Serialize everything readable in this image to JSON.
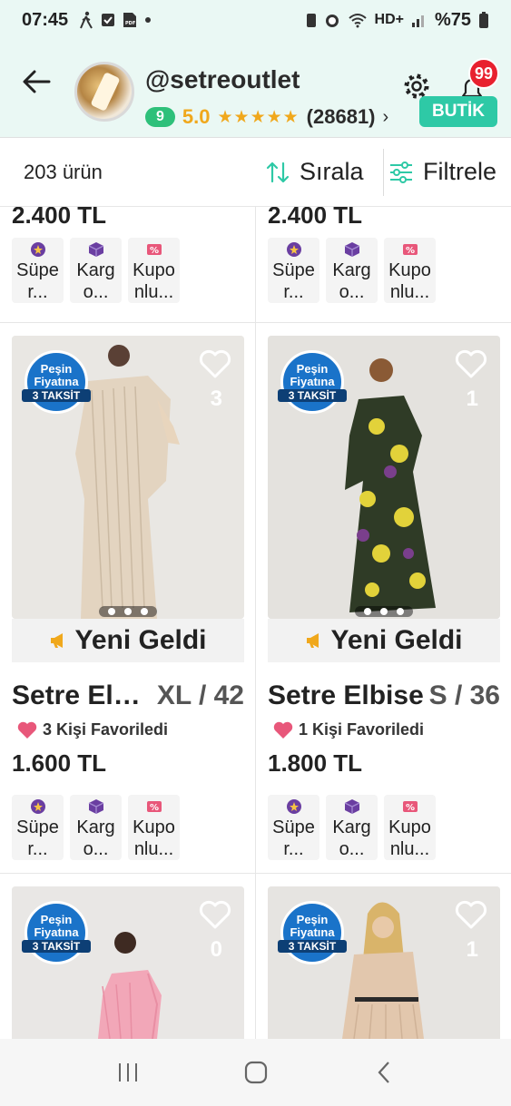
{
  "status_bar": {
    "time": "07:45",
    "battery": "%75",
    "network": "HD+"
  },
  "store": {
    "name": "@setreoutlet",
    "level": "9",
    "rating": "5.0",
    "stars": "★★★★★",
    "review_count": "(28681)",
    "chevron": "›",
    "notification_count": "99",
    "tag": "BUTİK"
  },
  "filter_bar": {
    "product_count": "203 ürün",
    "sort_label": "Sırala",
    "filter_label": "Filtrele"
  },
  "colors": {
    "accent": "#2ec9a6",
    "rating": "#f0a81c",
    "level": "#2ec07a",
    "badge": "#e8212f",
    "taksit": "#1a73c9"
  },
  "features": [
    {
      "label": "Süpe r...",
      "icon": "super-seller-icon",
      "color": "#6a3ea1"
    },
    {
      "label": "Karg o...",
      "icon": "cargo-box-icon",
      "color": "#6a3ea1"
    },
    {
      "label": "Kupo nlu...",
      "icon": "coupon-icon",
      "color": "#e8577a"
    }
  ],
  "products": [
    {
      "price": "2.400 TL"
    },
    {
      "price": "2.400 TL"
    },
    {
      "taksit_line1": "Peşin",
      "taksit_line2": "Fiyatına",
      "taksit_line3": "3 TAKSİT",
      "favorite_count": "3",
      "new_label": "Yeni Geldi",
      "name": "Setre Elbise",
      "size": "XL / 42",
      "favorites_text": "3 Kişi Favoriledi",
      "price": "1.600 TL"
    },
    {
      "taksit_line1": "Peşin",
      "taksit_line2": "Fiyatına",
      "taksit_line3": "3 TAKSİT",
      "favorite_count": "1",
      "new_label": "Yeni Geldi",
      "name": "Setre Elbise",
      "size": "S / 36",
      "favorites_text": "1 Kişi Favoriledi",
      "price": "1.800 TL"
    },
    {
      "taksit_line1": "Peşin",
      "taksit_line2": "Fiyatına",
      "taksit_line3": "3 TAKSİT",
      "favorite_count": "0"
    },
    {
      "taksit_line1": "Peşin",
      "taksit_line2": "Fiyatına",
      "taksit_line3": "3 TAKSİT",
      "favorite_count": "1"
    }
  ]
}
